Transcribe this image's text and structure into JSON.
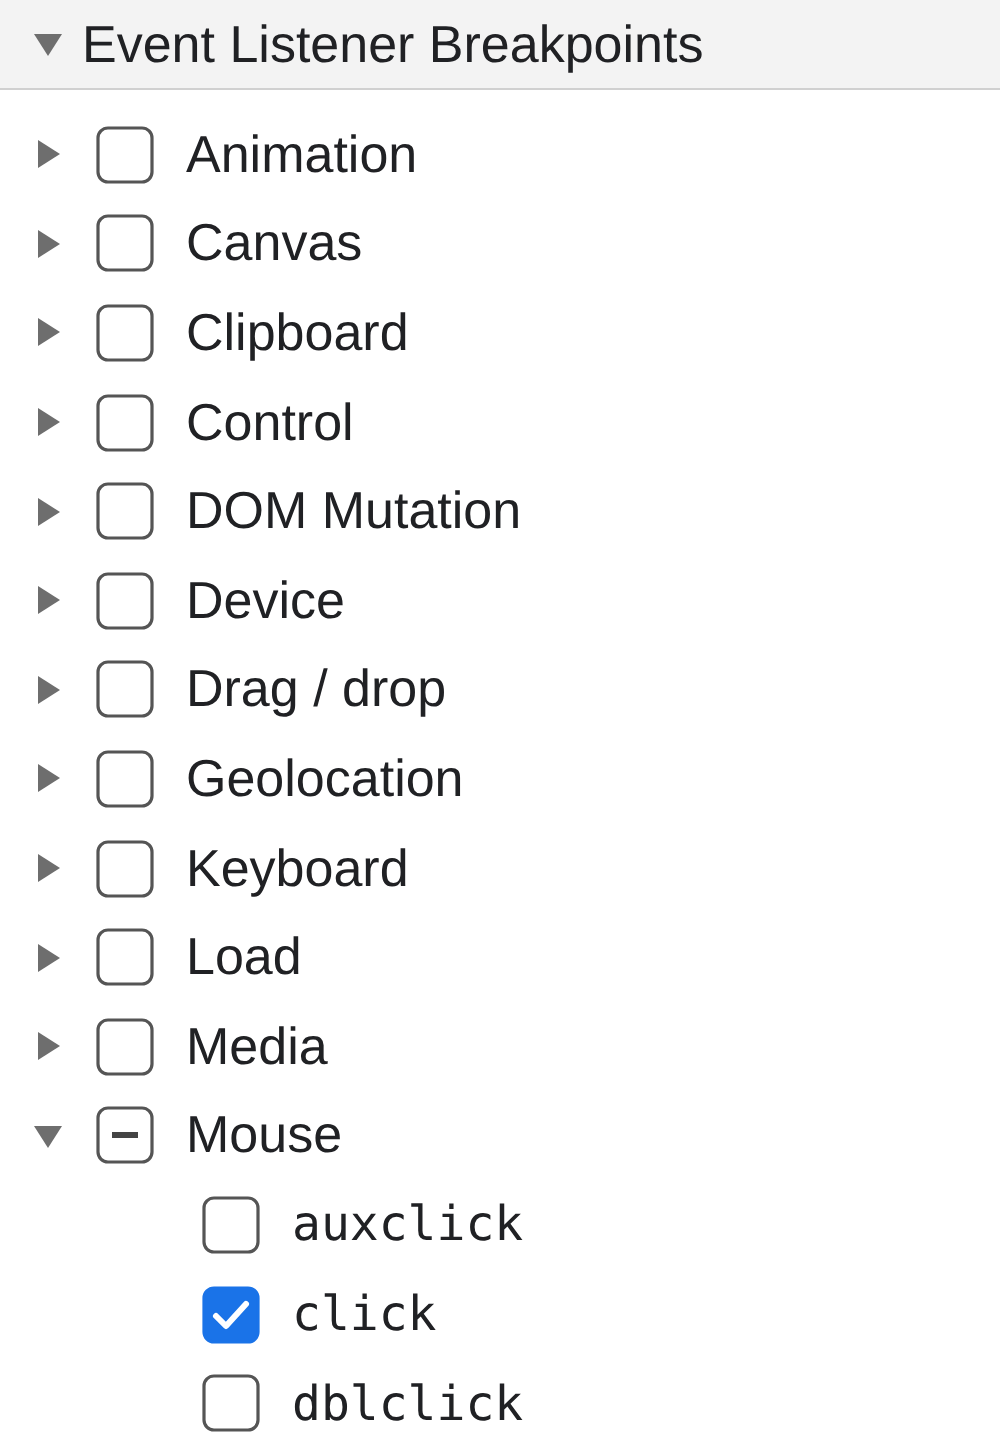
{
  "section": {
    "title": "Event Listener Breakpoints",
    "expanded": true
  },
  "categories": [
    {
      "label": "Animation",
      "expanded": false,
      "checked": false,
      "indeterminate": false
    },
    {
      "label": "Canvas",
      "expanded": false,
      "checked": false,
      "indeterminate": false
    },
    {
      "label": "Clipboard",
      "expanded": false,
      "checked": false,
      "indeterminate": false
    },
    {
      "label": "Control",
      "expanded": false,
      "checked": false,
      "indeterminate": false
    },
    {
      "label": "DOM Mutation",
      "expanded": false,
      "checked": false,
      "indeterminate": false
    },
    {
      "label": "Device",
      "expanded": false,
      "checked": false,
      "indeterminate": false
    },
    {
      "label": "Drag / drop",
      "expanded": false,
      "checked": false,
      "indeterminate": false
    },
    {
      "label": "Geolocation",
      "expanded": false,
      "checked": false,
      "indeterminate": false
    },
    {
      "label": "Keyboard",
      "expanded": false,
      "checked": false,
      "indeterminate": false
    },
    {
      "label": "Load",
      "expanded": false,
      "checked": false,
      "indeterminate": false
    },
    {
      "label": "Media",
      "expanded": false,
      "checked": false,
      "indeterminate": false
    },
    {
      "label": "Mouse",
      "expanded": true,
      "checked": false,
      "indeterminate": true,
      "children": [
        {
          "label": "auxclick",
          "checked": false
        },
        {
          "label": "click",
          "checked": true
        },
        {
          "label": "dblclick",
          "checked": false
        }
      ]
    }
  ]
}
